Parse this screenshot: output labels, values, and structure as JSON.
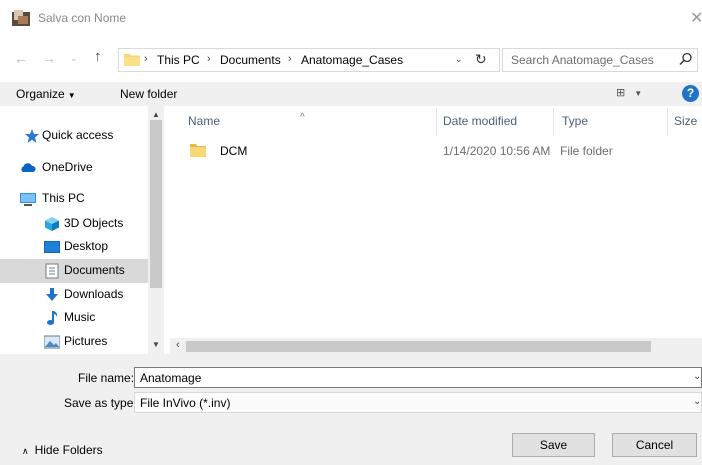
{
  "window": {
    "title": "Salva con Nome"
  },
  "nav": {
    "back": "←",
    "forward": "→",
    "recent": "⌄",
    "up": "↑"
  },
  "address": {
    "crumbs": [
      "This PC",
      "Documents",
      "Anatomage_Cases"
    ],
    "separator": "›",
    "dropdown": "⌄",
    "refresh": "↻"
  },
  "search": {
    "placeholder": "Search Anatomage_Cases"
  },
  "toolbar": {
    "organize": "Organize",
    "new_folder": "New folder",
    "help": "?"
  },
  "sidebar": {
    "items": [
      {
        "label": "Quick access",
        "icon": "star-icon"
      },
      {
        "label": "OneDrive",
        "icon": "cloud-icon"
      },
      {
        "label": "This PC",
        "icon": "computer-icon"
      },
      {
        "label": "3D Objects",
        "icon": "cube-icon"
      },
      {
        "label": "Desktop",
        "icon": "desktop-icon"
      },
      {
        "label": "Documents",
        "icon": "document-icon",
        "selected": true
      },
      {
        "label": "Downloads",
        "icon": "download-icon"
      },
      {
        "label": "Music",
        "icon": "music-icon"
      },
      {
        "label": "Pictures",
        "icon": "pictures-icon"
      }
    ]
  },
  "files": {
    "columns": [
      "Name",
      "Date modified",
      "Type",
      "Size"
    ],
    "rows": [
      {
        "name": "DCM",
        "date": "1/14/2020 10:56 AM",
        "type": "File folder"
      }
    ]
  },
  "form": {
    "file_name_label": "File name:",
    "file_name_value": "Anatomage",
    "save_type_label": "Save as type:",
    "save_type_value": "File InVivo (*.inv)"
  },
  "footer": {
    "hide_folders": "Hide Folders",
    "save": "Save",
    "cancel": "Cancel"
  },
  "colors": {
    "accent": "#1f74c9",
    "folder": "#f8d775",
    "selected": "#d9d9d9"
  }
}
